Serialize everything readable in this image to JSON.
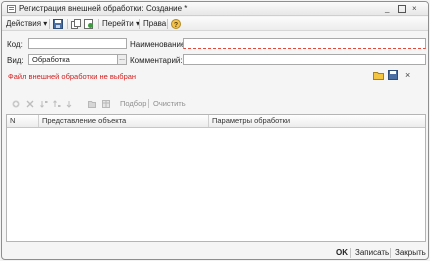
{
  "window": {
    "title": "Регистрация внешней обработки: Создание *",
    "buttons": [
      "_",
      "□",
      "×"
    ]
  },
  "toolbar": {
    "actions_label": "Действия",
    "goto_label": "Перейти",
    "rights_label": "Права",
    "help_glyph": "?"
  },
  "form": {
    "code_label": "Код:",
    "code_value": "",
    "name_label": "Наименование:",
    "name_value": "",
    "kind_label": "Вид:",
    "kind_value": "Обработка",
    "kind_picker": "...",
    "comment_label": "Комментарий:",
    "comment_value": "",
    "file_status": "Файл внешней обработки не выбран"
  },
  "file_actions": {
    "close_glyph": "×"
  },
  "table_toolbar": {
    "select_label": "Подбор",
    "clear_label": "Очистить"
  },
  "table": {
    "columns": [
      "N",
      "Представление объекта",
      "Параметры обработки"
    ],
    "rows": []
  },
  "footer": {
    "ok_label": "OK",
    "save_label": "Записать",
    "close_label": "Закрыть"
  },
  "colors": {
    "required_underline": "#e24b3b",
    "error_text": "#d41e1e"
  }
}
